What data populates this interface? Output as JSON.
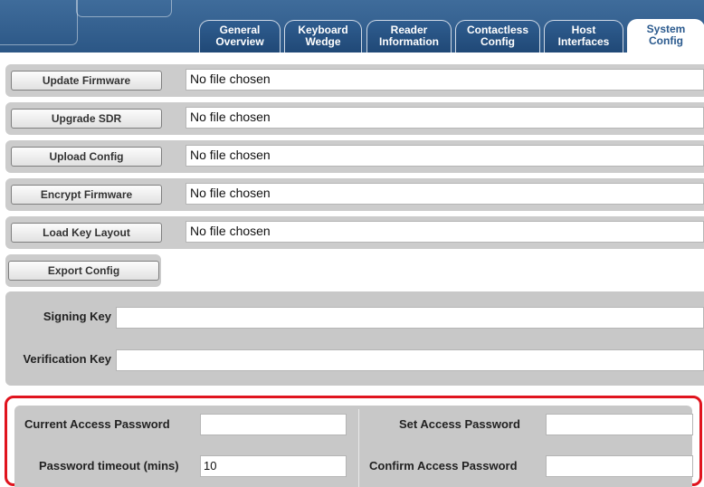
{
  "tabs": [
    {
      "line1": "General",
      "line2": "Overview",
      "active": false
    },
    {
      "line1": "Keyboard",
      "line2": "Wedge",
      "active": false
    },
    {
      "line1": "Reader",
      "line2": "Information",
      "active": false
    },
    {
      "line1": "Contactless",
      "line2": "Config",
      "active": false
    },
    {
      "line1": "Host",
      "line2": "Interfaces",
      "active": false
    },
    {
      "line1": "System",
      "line2": "Config",
      "active": true
    }
  ],
  "file_rows": [
    {
      "button": "Update Firmware",
      "file_status": "No file chosen"
    },
    {
      "button": "Upgrade SDR",
      "file_status": "No file chosen"
    },
    {
      "button": "Upload Config",
      "file_status": "No file chosen"
    },
    {
      "button": "Encrypt Firmware",
      "file_status": "No file chosen"
    },
    {
      "button": "Load Key Layout",
      "file_status": "No file chosen"
    }
  ],
  "export": {
    "button": "Export Config"
  },
  "keys": {
    "signing_label": "Signing Key",
    "signing_value": "",
    "verification_label": "Verification Key",
    "verification_value": ""
  },
  "password": {
    "current_label": "Current Access Password",
    "current_value": "",
    "set_label": "Set Access Password",
    "set_value": "",
    "timeout_label": "Password timeout (mins)",
    "timeout_value": "10",
    "confirm_label": "Confirm Access Password",
    "confirm_value": ""
  },
  "colors": {
    "header_blue": "#2a5584",
    "tab_blue": "#1f4775",
    "active_tab_text": "#2b5a8e",
    "panel_gray": "#cccccc",
    "highlight_red": "#e0141e"
  }
}
